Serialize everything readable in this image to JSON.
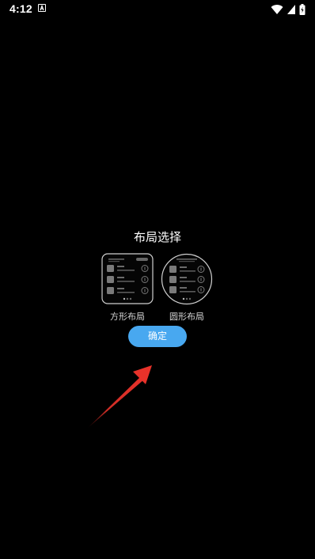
{
  "status_bar": {
    "time": "4:12",
    "icons": [
      "accessibility-a-icon",
      "wifi-icon",
      "signal-icon",
      "battery-charging-icon"
    ]
  },
  "dialog": {
    "title": "布局选择",
    "options": [
      {
        "label": "方形布局",
        "icon": "square-layout-icon"
      },
      {
        "label": "圆形布局",
        "icon": "round-layout-icon"
      }
    ],
    "confirm_label": "确定"
  },
  "colors": {
    "background": "#000000",
    "accent": "#48a8f0",
    "annotation_arrow": "#e8322a",
    "preview_outline": "#d0d0d0"
  }
}
